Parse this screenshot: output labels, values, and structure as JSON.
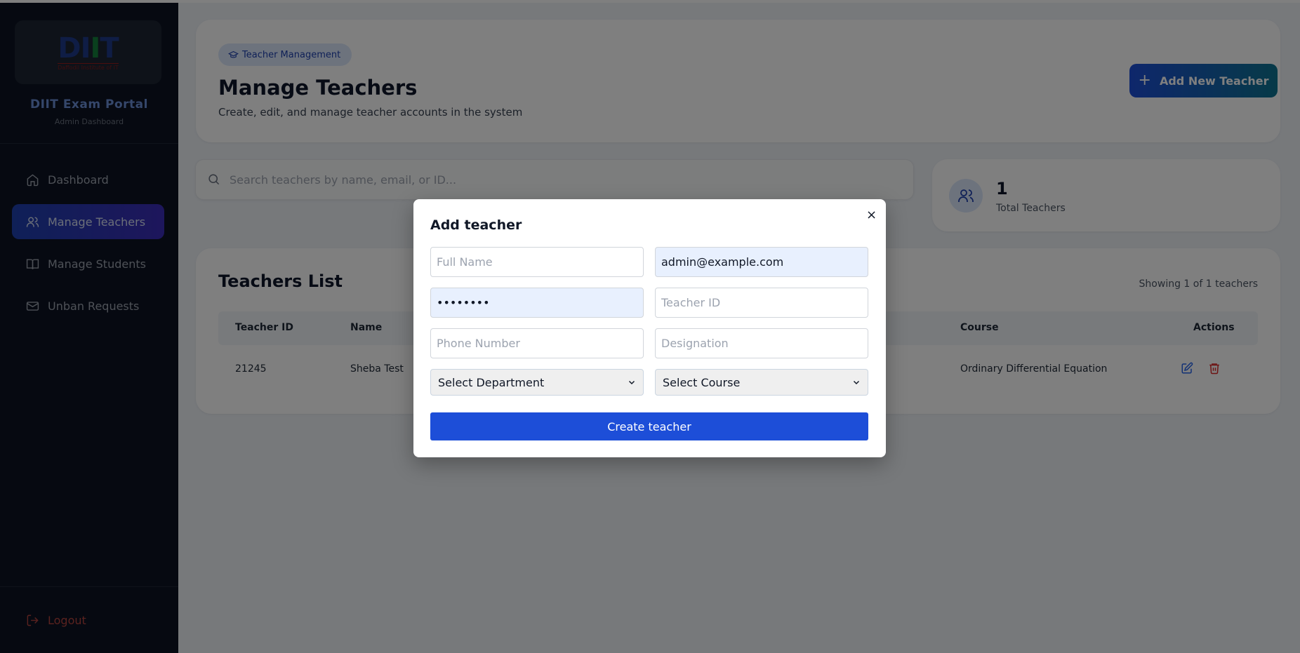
{
  "sidebar": {
    "logo_text": "DIIT",
    "logo_subtitle": "Daffodil Institute of IT",
    "portal_title": "DIIT Exam Portal",
    "portal_subtitle": "Admin Dashboard",
    "items": [
      {
        "label": "Dashboard",
        "icon": "home-icon",
        "active": false
      },
      {
        "label": "Manage Teachers",
        "icon": "users-icon",
        "active": true
      },
      {
        "label": "Manage Students",
        "icon": "book-icon",
        "active": false
      },
      {
        "label": "Unban Requests",
        "icon": "mail-icon",
        "active": false
      }
    ],
    "logout_label": "Logout"
  },
  "header": {
    "badge": "Teacher Management",
    "title": "Manage Teachers",
    "subtitle": "Create, edit, and manage teacher accounts in the system",
    "add_button": "Add New Teacher"
  },
  "search": {
    "placeholder": "Search teachers by name, email, or ID..."
  },
  "stats": {
    "total_value": "1",
    "total_label": "Total Teachers"
  },
  "list": {
    "title": "Teachers List",
    "count_text": "Showing 1 of 1 teachers",
    "columns": [
      "Teacher ID",
      "Name",
      "Course",
      "Actions"
    ],
    "rows": [
      {
        "teacher_id": "21245",
        "name": "Sheba Test",
        "course": "Ordinary Differential Equation"
      }
    ]
  },
  "modal": {
    "title": "Add teacher",
    "close": "×",
    "full_name_placeholder": "Full Name",
    "email_value": "admin@example.com",
    "password_value": "••••••••",
    "teacher_id_placeholder": "Teacher ID",
    "phone_placeholder": "Phone Number",
    "designation_placeholder": "Designation",
    "department_selected": "Select Department",
    "course_selected": "Select Course",
    "submit_label": "Create teacher"
  },
  "colors": {
    "sidebar_bg": "#0c1322",
    "accent": "#1d4ed8",
    "logout": "#b5443f",
    "delete": "#dc2626"
  }
}
